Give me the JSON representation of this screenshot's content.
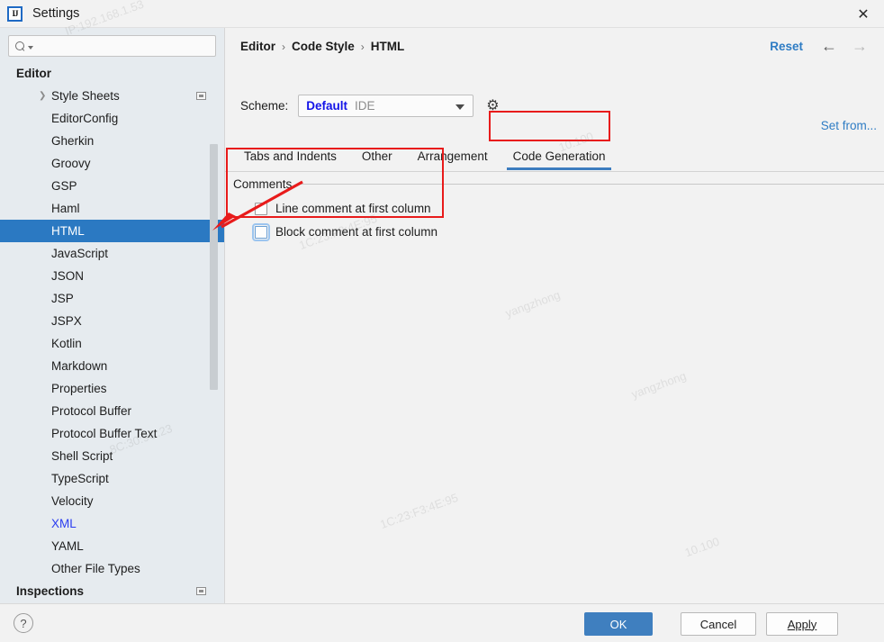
{
  "window": {
    "title": "Settings",
    "app_icon": "IJ",
    "close_label": "✕"
  },
  "search": {
    "value": "",
    "placeholder": "",
    "icon": "search-icon"
  },
  "sidebar": {
    "group_label": "Editor",
    "items": [
      {
        "label": "Style Sheets",
        "expandable": true,
        "badge": true
      },
      {
        "label": "EditorConfig"
      },
      {
        "label": "Gherkin"
      },
      {
        "label": "Groovy"
      },
      {
        "label": "GSP"
      },
      {
        "label": "Haml"
      },
      {
        "label": "HTML",
        "selected": true
      },
      {
        "label": "JavaScript"
      },
      {
        "label": "JSON"
      },
      {
        "label": "JSP"
      },
      {
        "label": "JSPX"
      },
      {
        "label": "Kotlin"
      },
      {
        "label": "Markdown"
      },
      {
        "label": "Properties"
      },
      {
        "label": "Protocol Buffer"
      },
      {
        "label": "Protocol Buffer Text"
      },
      {
        "label": "Shell Script"
      },
      {
        "label": "TypeScript"
      },
      {
        "label": "Velocity"
      },
      {
        "label": "XML",
        "modified": true
      },
      {
        "label": "YAML"
      },
      {
        "label": "Other File Types"
      }
    ],
    "footer_group": {
      "label": "Inspections",
      "badge": true
    }
  },
  "header": {
    "breadcrumb": [
      "Editor",
      "Code Style",
      "HTML"
    ],
    "separator": "›",
    "reset_label": "Reset",
    "back_icon": "←",
    "forward_icon": "→"
  },
  "scheme": {
    "label": "Scheme:",
    "name": "Default",
    "scope": "IDE",
    "gear_icon": "⚙",
    "set_from_label": "Set from..."
  },
  "tabs": [
    {
      "label": "Tabs and Indents",
      "active": false
    },
    {
      "label": "Other",
      "active": false
    },
    {
      "label": "Arrangement",
      "active": false
    },
    {
      "label": "Code Generation",
      "active": true
    }
  ],
  "settings": {
    "group_title": "Comments",
    "checkboxes": [
      {
        "label": "Line comment at first column",
        "checked": false,
        "focused": false
      },
      {
        "label": "Block comment at first column",
        "checked": false,
        "focused": true
      }
    ]
  },
  "footer": {
    "help_label": "?",
    "ok_label": "OK",
    "cancel_label": "Cancel",
    "apply_label": "Apply",
    "apply_mnemonic": "A"
  },
  "colors": {
    "accent_blue": "#2b79c2",
    "link_blue": "#2e7cc4",
    "annotation_red": "#e81b1b",
    "sidebar_bg": "#e6ebef",
    "panel_bg": "#f2f2f2"
  },
  "watermarks": [
    "IP:192.168.1.53",
    "1C:23:F3:4E:95",
    "10.100",
    "8C:30:9C:23",
    "yangzhong"
  ]
}
